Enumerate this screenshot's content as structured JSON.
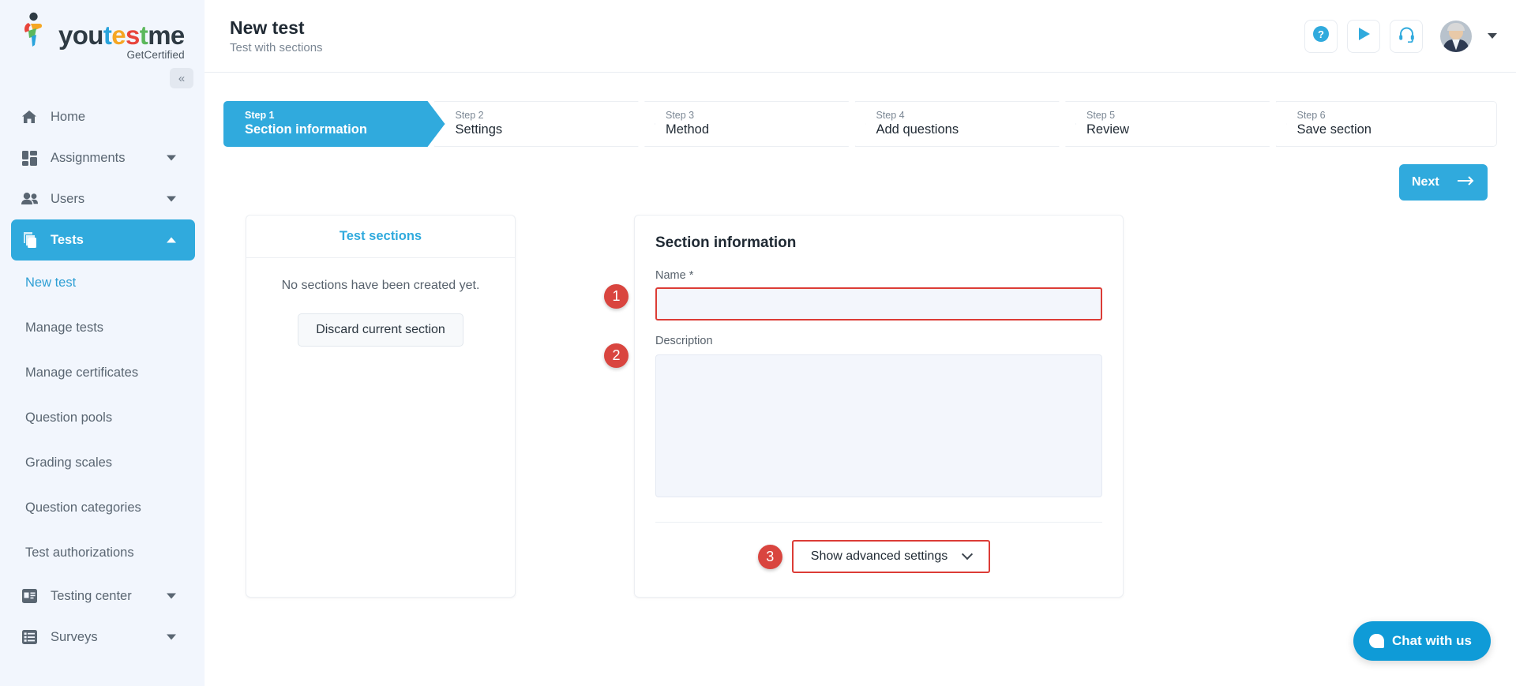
{
  "brand": {
    "name_parts": [
      {
        "text": "you",
        "color": "#2f3b44"
      },
      {
        "text": "t",
        "color": "#29a3dc"
      },
      {
        "text": "e",
        "color": "#f5a623"
      },
      {
        "text": "s",
        "color": "#e8453c"
      },
      {
        "text": "t",
        "color": "#5cb85c"
      },
      {
        "text": "me",
        "color": "#2f3b44"
      }
    ],
    "tagline": "GetCertified",
    "collapse_label": "«"
  },
  "sidebar": {
    "items": [
      {
        "label": "Home",
        "icon": "home-icon",
        "expandable": false,
        "active": false
      },
      {
        "label": "Assignments",
        "icon": "assignments-icon",
        "expandable": true,
        "active": false
      },
      {
        "label": "Users",
        "icon": "users-icon",
        "expandable": true,
        "active": false
      },
      {
        "label": "Tests",
        "icon": "tests-icon",
        "expandable": true,
        "active": true
      }
    ],
    "sub_items": [
      {
        "label": "New test",
        "current": true
      },
      {
        "label": "Manage tests",
        "current": false
      },
      {
        "label": "Manage certificates",
        "current": false
      },
      {
        "label": "Question pools",
        "current": false
      },
      {
        "label": "Grading scales",
        "current": false
      },
      {
        "label": "Question categories",
        "current": false
      },
      {
        "label": "Test authorizations",
        "current": false
      }
    ],
    "bottom_items": [
      {
        "label": "Testing center",
        "icon": "testing-center-icon",
        "expandable": true
      },
      {
        "label": "Surveys",
        "icon": "surveys-icon",
        "expandable": true
      }
    ]
  },
  "header": {
    "title": "New test",
    "subtitle": "Test with sections",
    "help_icon": "question-mark-icon",
    "play_icon": "play-icon",
    "support_icon": "headset-icon",
    "avatar": "user-avatar",
    "avatar_caret": "chevron-down-icon"
  },
  "stepper": {
    "steps": [
      {
        "num": "Step 1",
        "label": "Section information",
        "active": true
      },
      {
        "num": "Step 2",
        "label": "Settings",
        "active": false
      },
      {
        "num": "Step 3",
        "label": "Method",
        "active": false
      },
      {
        "num": "Step 4",
        "label": "Add questions",
        "active": false
      },
      {
        "num": "Step 5",
        "label": "Review",
        "active": false
      },
      {
        "num": "Step 6",
        "label": "Save section",
        "active": false
      }
    ]
  },
  "actions": {
    "next_label": "Next",
    "next_icon": "arrow-right-icon"
  },
  "test_sections": {
    "title": "Test sections",
    "empty_text": "No sections have been created yet.",
    "discard_label": "Discard current section"
  },
  "section_information": {
    "title": "Section information",
    "name_label": "Name *",
    "name_value": "",
    "name_placeholder": "",
    "description_label": "Description",
    "description_value": "",
    "description_placeholder": "",
    "advanced_label": "Show advanced settings",
    "advanced_icon": "chevron-down-icon"
  },
  "annotations": {
    "badges": [
      {
        "number": "1",
        "target": "name-input"
      },
      {
        "number": "2",
        "target": "description-textarea"
      },
      {
        "number": "3",
        "target": "show-advanced-settings-button"
      }
    ],
    "highlight_color": "#dc3c36"
  },
  "chat": {
    "label": "Chat with us",
    "icon": "chat-bubble-icon"
  },
  "colors": {
    "accent": "#30aadd",
    "sidebar_bg": "#f2f6fd",
    "input_bg": "#f3f6fc",
    "danger": "#d9453f"
  }
}
